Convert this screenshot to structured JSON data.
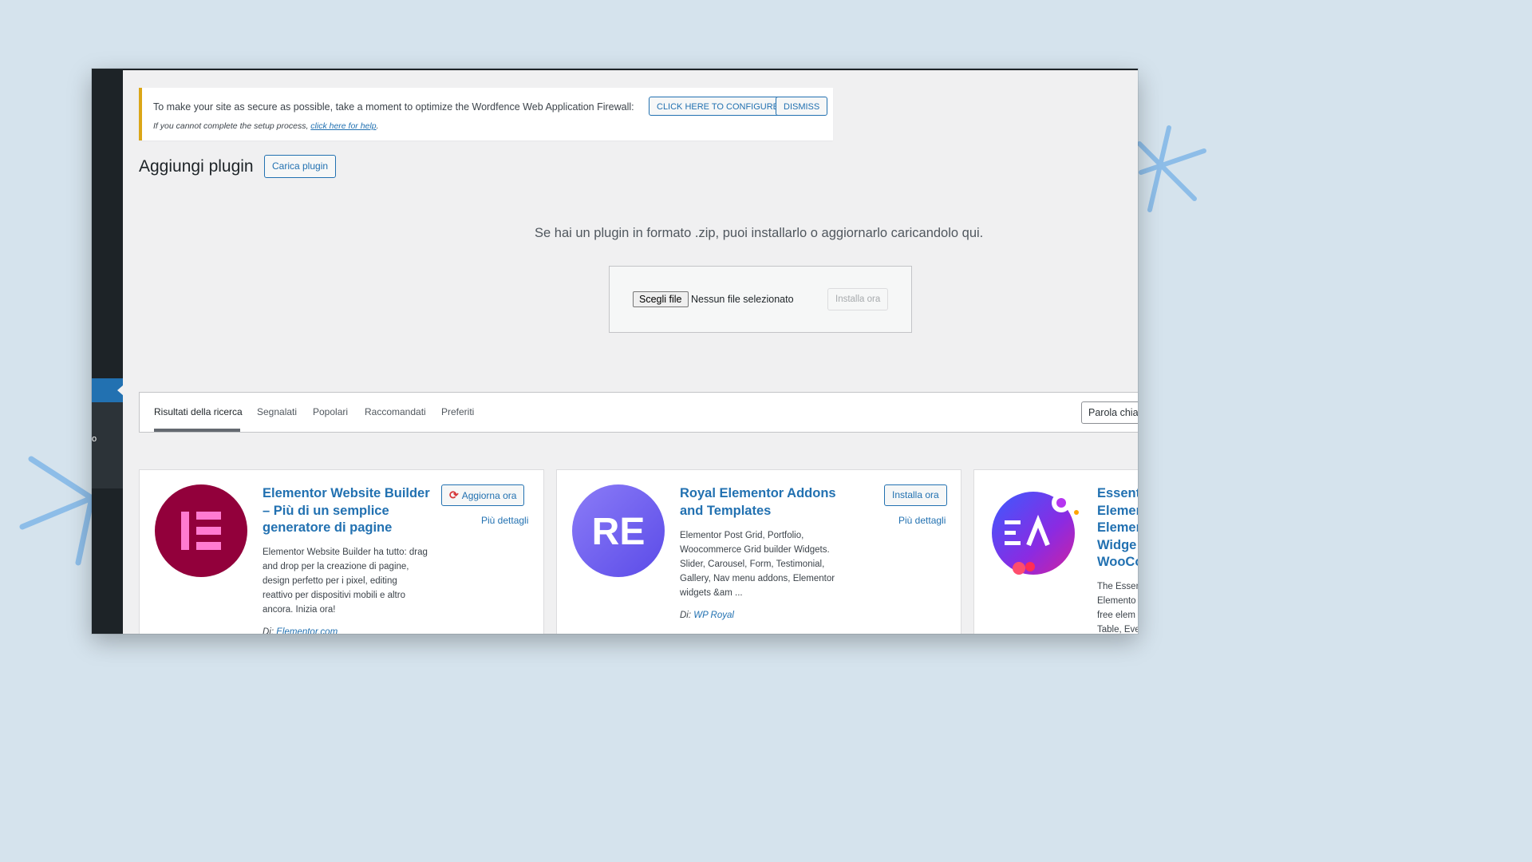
{
  "notice": {
    "message": "To make your site as secure as possible, take a moment to optimize the Wordfence Web Application Firewall:",
    "configure_label": "CLICK HERE TO CONFIGURE",
    "dismiss_label": "DISMISS",
    "help_prefix": "If you cannot complete the setup process, ",
    "help_link": "click here for help",
    "help_suffix": "."
  },
  "page": {
    "title": "Aggiungi plugin",
    "upload_button": "Carica plugin"
  },
  "upload": {
    "help_text": "Se hai un plugin in formato .zip, puoi installarlo o aggiornarlo caricandolo qui.",
    "choose_file": "Scegli file",
    "file_status": "Nessun file selezionato",
    "install_button": "Installa ora"
  },
  "sidebar": {
    "partial_label": "o"
  },
  "filters": {
    "tabs": [
      {
        "label": "Risultati della ricerca"
      },
      {
        "label": "Segnalati"
      },
      {
        "label": "Popolari"
      },
      {
        "label": "Raccomandati"
      },
      {
        "label": "Preferiti"
      }
    ],
    "search_type": "Parola chiav"
  },
  "plugins": [
    {
      "title_lines": [
        "Elementor Website Builder",
        "– Più di un semplice",
        "generatore di pagine"
      ],
      "action": "Aggiorna ora",
      "more": "Più dettagli",
      "desc_lines": [
        "Elementor Website Builder ha tutto: drag",
        "and drop per la creazione di pagine,",
        "design perfetto per i pixel, editing",
        "reattivo per dispositivi mobili e altro",
        "ancora. Inizia ora!"
      ],
      "author_prefix": "Di: ",
      "author": "Elementor.com",
      "icon": "elementor-logo-icon",
      "icon_color": "#92003b"
    },
    {
      "title_lines": [
        "Royal Elementor Addons",
        "and Templates"
      ],
      "action": "Installa ora",
      "more": "Più dettagli",
      "desc_lines": [
        "Elementor Post Grid, Portfolio,",
        "Woocommerce Grid builder Widgets.",
        "Slider, Carousel, Form, Testimonial,",
        "Gallery, Nav menu addons, Elementor",
        "widgets &am ..."
      ],
      "author_prefix": "Di: ",
      "author": "WP Royal",
      "icon": "royal-addons-logo-icon",
      "icon_color": "#6a5cf0"
    },
    {
      "title_lines": [
        "Essenti",
        "Elemen",
        "Elemen",
        "Widge",
        "WooCo"
      ],
      "desc_lines": [
        "The Essen",
        "Elemento",
        "free elem",
        "Table, Eve"
      ],
      "icon": "essential-addons-logo-icon",
      "icon_color": "#6f3df5"
    }
  ],
  "colors": {
    "accent": "#2271b1",
    "notice_border": "#dba617",
    "sidebar": "#1d2327",
    "background": "#d5e3ed"
  }
}
